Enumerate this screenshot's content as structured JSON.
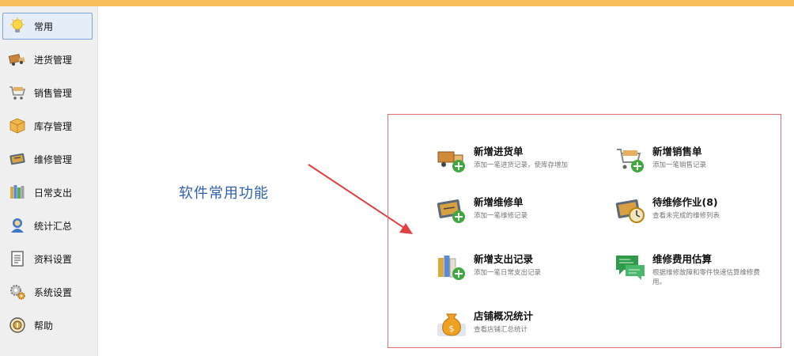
{
  "sidebar": {
    "items": [
      {
        "label": "常用",
        "icon": "lightbulb-icon",
        "active": true
      },
      {
        "label": "进货管理",
        "icon": "truck-icon"
      },
      {
        "label": "销售管理",
        "icon": "shopping-cart-icon"
      },
      {
        "label": "库存管理",
        "icon": "box-icon"
      },
      {
        "label": "维修管理",
        "icon": "toolbox-icon"
      },
      {
        "label": "日常支出",
        "icon": "books-icon"
      },
      {
        "label": "统计汇总",
        "icon": "user-stats-icon"
      },
      {
        "label": "资料设置",
        "icon": "document-icon"
      },
      {
        "label": "系统设置",
        "icon": "gears-icon"
      },
      {
        "label": "帮助",
        "icon": "help-icon"
      }
    ]
  },
  "main": {
    "heading": "软件常用功能",
    "functions": [
      {
        "title": "新增进货单",
        "desc": "添加一笔进货记录，使库存增加",
        "icon": "truck-add-icon"
      },
      {
        "title": "新增销售单",
        "desc": "添加一笔销售记录",
        "icon": "cart-add-icon"
      },
      {
        "title": "新增维修单",
        "desc": "添加一笔维修记录",
        "icon": "toolbox-add-icon"
      },
      {
        "title": "待维修作业(8)",
        "desc": "查看未完成的维修列表",
        "icon": "clock-toolbox-icon"
      },
      {
        "title": "新增支出记录",
        "desc": "添加一笔日常支出记录",
        "icon": "books-add-icon"
      },
      {
        "title": "维修费用估算",
        "desc": "根据维修故障和零件快速估算维修费用。",
        "icon": "chat-estimate-icon"
      },
      {
        "title": "店铺概况统计",
        "desc": "查看店铺汇总统计",
        "icon": "money-bag-icon"
      }
    ]
  },
  "colors": {
    "topbar": "#f7c05a",
    "sidebar_bg": "#efefef",
    "active_border": "#79a6dc",
    "heading": "#2f5fb3",
    "panel_border": "#e07070",
    "arrow": "#e04040"
  }
}
